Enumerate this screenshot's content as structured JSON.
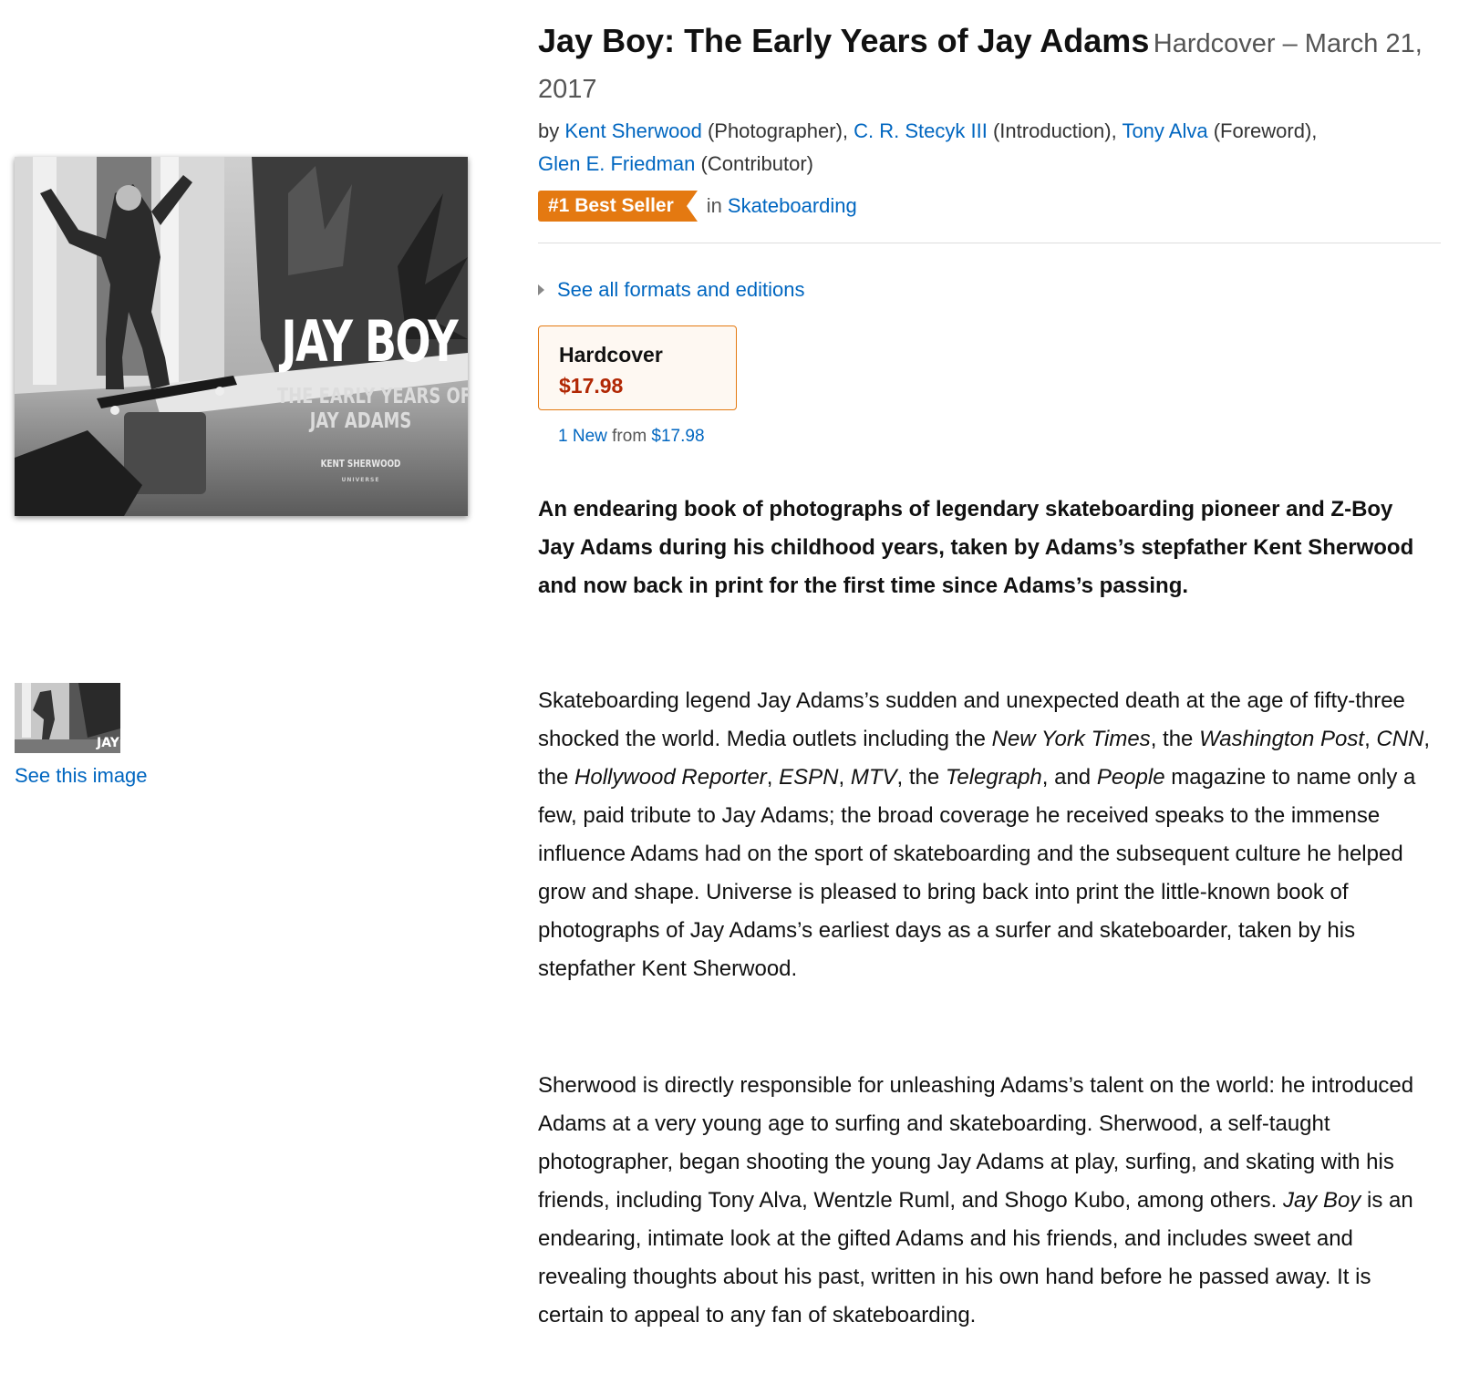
{
  "product": {
    "title": "Jay Boy: The Early Years of Jay Adams",
    "format_suffix": "Hardcover – March 21, 2017"
  },
  "byline": {
    "by": "by",
    "contributors": [
      {
        "name": "Kent Sherwood",
        "role": "(Photographer),"
      },
      {
        "name": "C. R. Stecyk III",
        "role": "(Introduction),"
      },
      {
        "name": "Tony Alva",
        "role": "(Foreword),"
      },
      {
        "name": "Glen E. Friedman",
        "role": "(Contributor)"
      }
    ]
  },
  "badge": {
    "label": "#1 Best Seller",
    "in": "in",
    "category": "Skateboarding",
    "color": "#e47911"
  },
  "cover": {
    "title": "JAY BOY",
    "subtitle_line1": "THE EARLY YEARS OF",
    "subtitle_line2": "JAY ADAMS",
    "author": "KENT SHERWOOD",
    "publisher": "UNIVERSE"
  },
  "gallery": {
    "see_image": "See this image"
  },
  "formats": {
    "see_all": "See all formats and editions",
    "selected_name": "Hardcover",
    "selected_price": "$17.98",
    "offers_new": "1 New",
    "offers_from": "from",
    "offers_price": "$17.98"
  },
  "description": {
    "lead": "An endearing book of photographs of legendary skateboarding pioneer and Z-Boy Jay Adams during his childhood years, taken by Adams’s stepfather Kent Sherwood and now back in print for the first time since Adams’s passing.",
    "p1": {
      "a": "Skateboarding legend Jay Adams’s sudden and unexpected death at the age of fifty-three shocked the world. Media outlets including the ",
      "nyt": "New York Times",
      "b": ", the ",
      "wapo": "Washington Post",
      "c": ", ",
      "cnn": "CNN",
      "d": ", the ",
      "hr": "Hollywood Reporter",
      "e": ", ",
      "espn": "ESPN",
      "f": ", ",
      "mtv": "MTV",
      "g": ", the ",
      "tele": "Telegraph",
      "h": ", and ",
      "people": "People",
      "i": " magazine to name only a few, paid tribute to Jay Adams; the broad coverage he received speaks to the immense influence Adams had on the sport of skateboarding and the subsequent culture he helped grow and shape. Universe is pleased to bring back into print the little-known book of photographs of Jay Adams’s earliest days as a surfer and skateboarder, taken by his stepfather Kent Sherwood."
    },
    "p2": {
      "a": "Sherwood is directly responsible for unleashing Adams’s talent on the world: he introduced Adams at a very young age to surfing and skateboarding. Sherwood, a self-taught photographer, began shooting the young Jay Adams at play, surfing, and skating with his friends, including Tony Alva, Wentzle Ruml, and Shogo Kubo, among others. ",
      "jayboy": "Jay Boy",
      "b": " is an endearing, intimate look at the gifted Adams and his friends, and includes sweet and revealing thoughts about his past, written in his own hand before he passed away. It is certain to appeal to any fan of skateboarding."
    }
  },
  "colors": {
    "link": "#0066c0",
    "price": "#b12704",
    "accent": "#e47911"
  }
}
